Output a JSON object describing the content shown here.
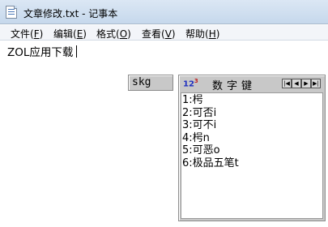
{
  "window": {
    "title": "文章修改.txt - 记事本"
  },
  "menu": [
    {
      "label": "文件(",
      "key": "F",
      "end": ")",
      "name": "menu-file"
    },
    {
      "label": "编辑(",
      "key": "E",
      "end": ")",
      "name": "menu-edit"
    },
    {
      "label": "格式(",
      "key": "O",
      "end": ")",
      "name": "menu-format"
    },
    {
      "label": "查看(",
      "key": "V",
      "end": ")",
      "name": "menu-view"
    },
    {
      "label": "帮助(",
      "key": "H",
      "end": ")",
      "name": "menu-help"
    }
  ],
  "editor": {
    "text": "ZOL应用下载"
  },
  "ime": {
    "input": "skg",
    "logo": "12",
    "logo_sup": "3",
    "title": "数字键",
    "nav_buttons": [
      "|◀",
      "◀",
      "▶",
      "▶|"
    ],
    "candidates": [
      "1:枵",
      "2:可否i",
      "3:可不i",
      "4:枵n",
      "5:可恶o",
      "6:极品五笔t"
    ]
  }
}
